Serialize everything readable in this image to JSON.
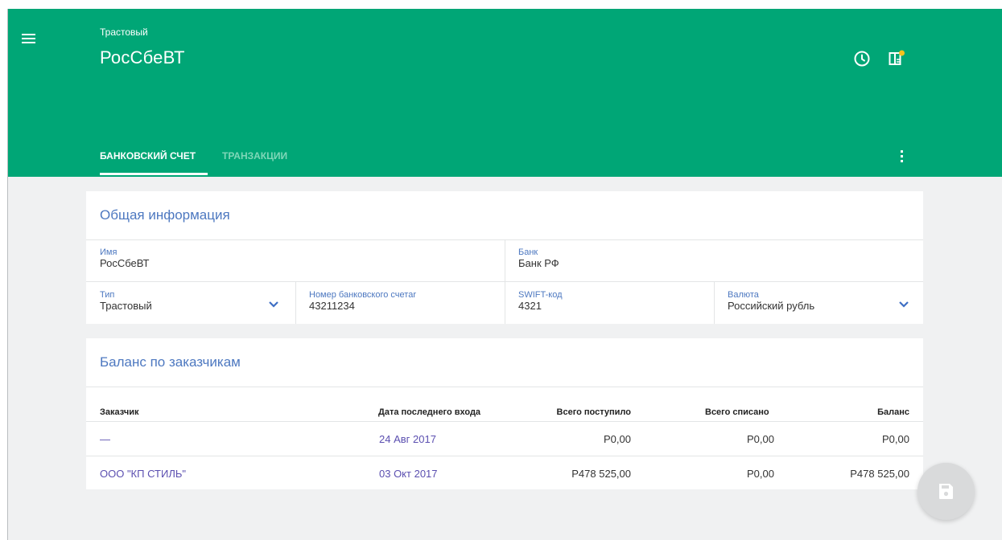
{
  "header": {
    "subtitle": "Трастовый",
    "title": "РосСбеВТ",
    "icons": [
      "menu-icon",
      "clock-icon",
      "notes-icon",
      "more-vert-icon"
    ],
    "accent": "#00a676",
    "badge_color": "#f7c21c"
  },
  "tabs": [
    {
      "label": "БАНКОВСКИЙ СЧЕТ",
      "active": true
    },
    {
      "label": "ТРАНЗАКЦИИ",
      "active": false
    }
  ],
  "general": {
    "title": "Общая информация",
    "name": {
      "label": "Имя",
      "value": "РосСбеВТ"
    },
    "bank": {
      "label": "Банк",
      "value": "Банк РФ"
    },
    "type": {
      "label": "Тип",
      "value": "Трастовый"
    },
    "account": {
      "label": "Номер банковского счетаr",
      "value": "43211234"
    },
    "swift": {
      "label": "SWIFT-код",
      "value": "4321"
    },
    "currency": {
      "label": "Валюта",
      "value": "Российский рубль"
    }
  },
  "balance": {
    "title": "Баланс по заказчикам",
    "columns": [
      "Заказчик",
      "Дата последнего входа",
      "Всего поступило",
      "Всего списано",
      "Баланс"
    ],
    "rows": [
      {
        "customer": "—",
        "date": "24 Авг 2017",
        "received": "Р0,00",
        "written_off": "Р0,00",
        "balance": "Р0,00"
      },
      {
        "customer": "ООО \"КП СТИЛЬ\"",
        "date": "03 Окт 2017",
        "received": "Р478 525,00",
        "written_off": "Р0,00",
        "balance": "Р478 525,00"
      }
    ]
  },
  "fab": {
    "icon": "save-icon"
  }
}
